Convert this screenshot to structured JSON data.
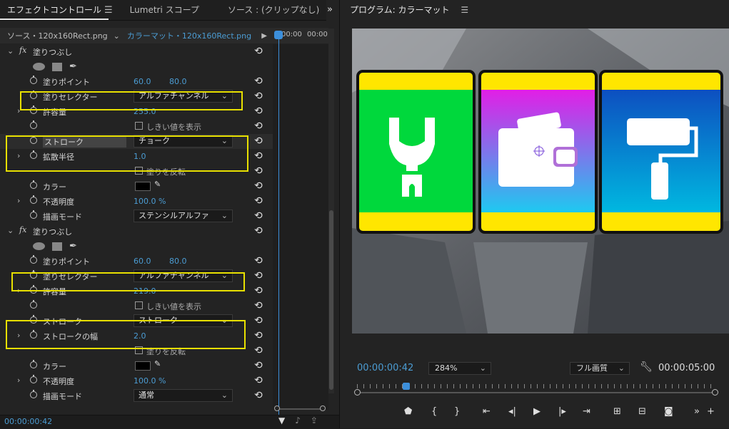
{
  "left_panel": {
    "tabs": [
      "エフェクトコントロール",
      "Lumetri スコープ",
      "ソース : (クリップなし)"
    ],
    "menu_icon": "hamburger-icon",
    "overflow_icon": "double-chevron-right-icon",
    "source_label": "ソース・120x160Rect.png",
    "clip_label": "カラーマット・120x160Rect.png",
    "timeline_times": [
      "00:00",
      "00:00"
    ],
    "effect1": {
      "name": "塗りつぶし",
      "fill_point_label": "塗りポイント",
      "fill_point_x": "60.0",
      "fill_point_y": "80.0",
      "selector_label": "塗りセレクター",
      "selector_value": "アルファチャンネル",
      "tolerance_label": "許容量",
      "tolerance_value": "255.0",
      "threshold_label": "しきい値を表示",
      "stroke_label": "ストローク",
      "stroke_value": "チョーク",
      "radius_label": "拡散半径",
      "radius_value": "1.0",
      "invert_label": "塗りを反転",
      "color_label": "カラー",
      "opacity_label": "不透明度",
      "opacity_value": "100.0 %",
      "blend_label": "描画モード",
      "blend_value": "ステンシルアルファ"
    },
    "effect2": {
      "name": "塗りつぶし",
      "fill_point_label": "塗りポイント",
      "fill_point_x": "60.0",
      "fill_point_y": "80.0",
      "selector_label": "塗りセレクター",
      "selector_value": "アルファチャンネル",
      "tolerance_label": "許容量",
      "tolerance_value": "219.0",
      "threshold_label": "しきい値を表示",
      "stroke_label": "ストローク",
      "stroke_value": "ストローク",
      "width_label": "ストロークの幅",
      "width_value": "2.0",
      "invert_label": "塗りを反転",
      "color_label": "カラー",
      "opacity_label": "不透明度",
      "opacity_value": "100.0 %",
      "blend_label": "描画モード",
      "blend_value": "通常"
    },
    "current_time": "00:00:00:42"
  },
  "program": {
    "title": "プログラム: カラーマット",
    "timecode": "00:00:00:42",
    "zoom": "284%",
    "quality": "フル画質",
    "duration": "00:00:05:00",
    "colors": {
      "accent_blue": "#4b9cd3",
      "highlight": "#e8e000",
      "card_yellow": "#ffe600",
      "card_green": "#00d83c",
      "card_magenta": "#e020e6",
      "card_blue": "#1568c8"
    },
    "card_icons": [
      "wrench-icon",
      "wallet-icon",
      "paint-roller-icon"
    ]
  }
}
